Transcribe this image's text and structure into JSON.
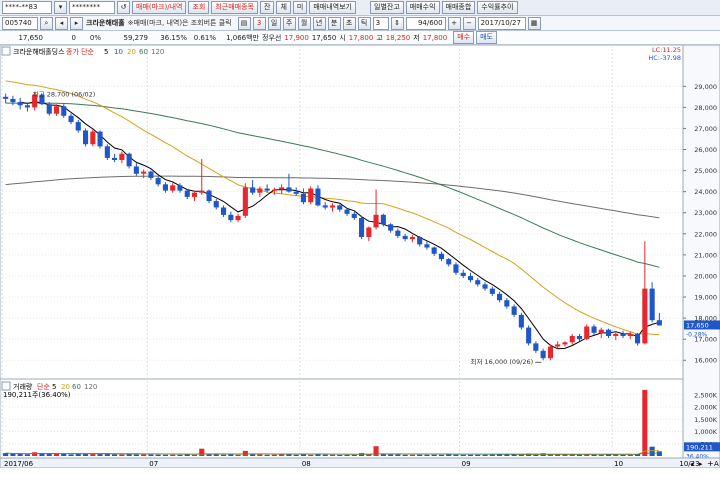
{
  "toolbar": {
    "account": "****-**83",
    "password": "********",
    "tab_trade": "매매(마크)/내역",
    "query_btn": "조회",
    "recent_trade": "최근매매종목",
    "balance_btn": "잔",
    "contract_btn": "체",
    "unfilled_btn": "미",
    "trade_history_view": "매매내역보기",
    "daily_balance": "일별잔고",
    "trade_profit": "매매수익",
    "trade_total": "매매종합",
    "profit_rate": "수익률추이"
  },
  "symbol_row": {
    "code": "005740",
    "name": "크라운해태홀",
    "hint": "※매매(마크, 내역)은 조회버튼 클릭",
    "period_num": "3",
    "period_units": [
      "일",
      "주",
      "월",
      "년",
      "분",
      "초",
      "틱"
    ],
    "count_value": "3",
    "page_counter": "94/600",
    "date": "2017/10/27"
  },
  "price_row": {
    "price": "17,650",
    "change": "0",
    "change_pct": "0%",
    "volume_pct": "59,279",
    "turnover_rate": "36.15%",
    "value_rate": "0.61%",
    "amount": "1,066백만",
    "prev_label": "정우선",
    "prev_val": "17,900",
    "curr_val": "17,650",
    "open_label": "시",
    "open_val": "17,800",
    "high_label": "고",
    "high_val": "18,250",
    "low_label": "저",
    "low_val": "17,800",
    "buy_btn": "매수",
    "sell_btn": "매도"
  },
  "chart_data": [
    {
      "type": "candlestick",
      "title": "크라운해태홀딩스",
      "legend": [
        "종가 단순",
        "5",
        "10",
        "20",
        "60",
        "120"
      ],
      "ma_colors": {
        "5": "#000000",
        "20": "#d4a21a",
        "60": "#3a7a56",
        "120": "#6d6d6d"
      },
      "info_right": [
        "LC:11.25",
        "HC:-37.98"
      ],
      "yticks": [
        16000,
        17000,
        18000,
        19000,
        20000,
        21000,
        22000,
        23000,
        24000,
        25000,
        26000,
        27000,
        28000,
        29000
      ],
      "ylim": [
        15300,
        30200
      ],
      "current_label": "17,650",
      "current_sub": "-0.28%",
      "annotation_high": "최고 28,700 (06/02)",
      "annotation_low": "최저 16,000 (09/26)",
      "candles": [
        [
          28500,
          28650,
          28200,
          28400
        ],
        [
          28400,
          28550,
          28100,
          28250
        ],
        [
          28250,
          28450,
          27900,
          28100
        ],
        [
          28100,
          28200,
          27800,
          28000
        ],
        [
          28000,
          28700,
          27850,
          28600
        ],
        [
          28600,
          28650,
          28100,
          28150
        ],
        [
          28150,
          28250,
          27600,
          27700
        ],
        [
          27700,
          28150,
          27600,
          28050
        ],
        [
          28050,
          28150,
          27500,
          27600
        ],
        [
          27600,
          27700,
          27200,
          27300
        ],
        [
          27300,
          27400,
          26800,
          26900
        ],
        [
          26900,
          27000,
          26150,
          26250
        ],
        [
          26250,
          26950,
          26150,
          26850
        ],
        [
          26850,
          26900,
          26050,
          26150
        ],
        [
          26150,
          26250,
          25500,
          25600
        ],
        [
          25600,
          25800,
          25400,
          25500
        ],
        [
          25500,
          25900,
          25350,
          25800
        ],
        [
          25800,
          25850,
          25100,
          25200
        ],
        [
          25200,
          25350,
          24750,
          24850
        ],
        [
          24850,
          25050,
          24650,
          24950
        ],
        [
          24950,
          25000,
          24550,
          24650
        ],
        [
          24650,
          24750,
          24250,
          24350
        ],
        [
          24350,
          24450,
          23950,
          24050
        ],
        [
          24050,
          24400,
          23950,
          24300
        ],
        [
          24300,
          24400,
          23950,
          24050
        ],
        [
          24050,
          24100,
          23650,
          23750
        ],
        [
          23750,
          24050,
          23550,
          23950
        ],
        [
          23950,
          25550,
          23850,
          24050
        ],
        [
          24050,
          24100,
          23450,
          23550
        ],
        [
          23550,
          23650,
          23150,
          23250
        ],
        [
          23250,
          23350,
          22800,
          22900
        ],
        [
          22900,
          23050,
          22550,
          22650
        ],
        [
          22650,
          22950,
          22550,
          22850
        ],
        [
          22850,
          24400,
          22750,
          24200
        ],
        [
          24200,
          24550,
          23850,
          23950
        ],
        [
          23950,
          24250,
          23750,
          24150
        ],
        [
          24150,
          24350,
          23950,
          24050
        ],
        [
          24050,
          24200,
          23850,
          24100
        ],
        [
          24100,
          24350,
          23900,
          24200
        ],
        [
          24200,
          24850,
          23950,
          24000
        ],
        [
          24000,
          24200,
          23800,
          23900
        ],
        [
          23900,
          24150,
          23400,
          23500
        ],
        [
          23500,
          24250,
          23400,
          24150
        ],
        [
          24150,
          24300,
          23300,
          23350
        ],
        [
          23350,
          23500,
          23150,
          23250
        ],
        [
          23250,
          23450,
          23050,
          23350
        ],
        [
          23350,
          23400,
          23050,
          23150
        ],
        [
          23150,
          23200,
          22850,
          22950
        ],
        [
          22950,
          23050,
          22650,
          22750
        ],
        [
          22750,
          22850,
          21750,
          21850
        ],
        [
          21850,
          22350,
          21650,
          22300
        ],
        [
          22300,
          24100,
          22200,
          22900
        ],
        [
          22900,
          22950,
          22350,
          22450
        ],
        [
          22450,
          22500,
          22050,
          22150
        ],
        [
          22150,
          22250,
          21800,
          21900
        ],
        [
          21900,
          22000,
          21650,
          21750
        ],
        [
          21750,
          21950,
          21600,
          21850
        ],
        [
          21850,
          21900,
          21400,
          21500
        ],
        [
          21500,
          21650,
          21250,
          21350
        ],
        [
          21350,
          21400,
          20950,
          21050
        ],
        [
          21050,
          21150,
          20700,
          20800
        ],
        [
          20800,
          20850,
          20450,
          20550
        ],
        [
          20550,
          20650,
          20050,
          20150
        ],
        [
          20150,
          20300,
          19900,
          20000
        ],
        [
          20000,
          20150,
          19700,
          19800
        ],
        [
          19800,
          19900,
          19500,
          19600
        ],
        [
          19600,
          19700,
          19300,
          19400
        ],
        [
          19400,
          19500,
          19050,
          19150
        ],
        [
          19150,
          19250,
          18750,
          18850
        ],
        [
          18850,
          18950,
          18450,
          18550
        ],
        [
          18550,
          18650,
          18050,
          18150
        ],
        [
          18150,
          18250,
          17450,
          17550
        ],
        [
          17550,
          17650,
          16700,
          16800
        ],
        [
          16800,
          16900,
          16350,
          16450
        ],
        [
          16450,
          16550,
          16000,
          16100
        ],
        [
          16100,
          16750,
          16000,
          16650
        ],
        [
          16650,
          16900,
          16550,
          16750
        ],
        [
          16750,
          16900,
          16650,
          16850
        ],
        [
          16850,
          17250,
          16750,
          17150
        ],
        [
          17150,
          17250,
          16900,
          17000
        ],
        [
          17000,
          17700,
          16950,
          17600
        ],
        [
          17600,
          17700,
          17200,
          17300
        ],
        [
          17300,
          17550,
          17050,
          17450
        ],
        [
          17450,
          17500,
          17050,
          17150
        ],
        [
          17150,
          17300,
          16950,
          17250
        ],
        [
          17250,
          17400,
          17050,
          17150
        ],
        [
          17150,
          17350,
          17000,
          17250
        ],
        [
          17250,
          17300,
          16700,
          16800
        ],
        [
          16800,
          21650,
          16750,
          19400
        ],
        [
          19400,
          19700,
          17800,
          17900
        ],
        [
          17900,
          18250,
          17800,
          17650
        ]
      ]
    },
    {
      "type": "bar",
      "title": "거래량",
      "legend": [
        "거래량",
        "단순",
        "5",
        "20",
        "60",
        "120"
      ],
      "legend_value": "190,211주(36.40%)",
      "yticks_label": [
        "500K",
        "1,000K",
        "1,500K",
        "2,000K",
        "2,500K"
      ],
      "yticks": [
        500000,
        1000000,
        1500000,
        2000000,
        2500000
      ],
      "ylim": [
        0,
        2900000
      ],
      "current_label": "190,211",
      "current_sub": "36.40%",
      "values": [
        120000,
        90000,
        80000,
        70000,
        150000,
        110000,
        100000,
        90000,
        80000,
        70000,
        90000,
        95000,
        80000,
        90000,
        85000,
        70000,
        60000,
        80000,
        60000,
        70000,
        60000,
        55000,
        50000,
        55000,
        50000,
        60000,
        50000,
        300000,
        70000,
        60000,
        55000,
        60000,
        50000,
        210000,
        90000,
        60000,
        50000,
        55000,
        60000,
        80000,
        50000,
        60000,
        50000,
        70000,
        55000,
        50000,
        45000,
        50000,
        50000,
        120000,
        80000,
        400000,
        90000,
        70000,
        60000,
        50000,
        50000,
        55000,
        50000,
        55000,
        50000,
        60000,
        55000,
        50000,
        50000,
        50000,
        50000,
        55000,
        60000,
        60000,
        70000,
        90000,
        100000,
        90000,
        110000,
        80000,
        70000,
        60000,
        60000,
        55000,
        60000,
        55000,
        50000,
        60000,
        60000,
        50000,
        55000,
        80000,
        2700000,
        380000,
        190000
      ]
    }
  ],
  "xaxis": {
    "labels": [
      "2017/06",
      "07",
      "08",
      "09",
      "10",
      "10/23"
    ]
  },
  "colors": {
    "up": "#e8262c",
    "down": "#1f57c8",
    "ma5": "#000000",
    "ma20": "#d4a21a",
    "ma60": "#3a7a56",
    "ma120": "#6d6d6d"
  }
}
